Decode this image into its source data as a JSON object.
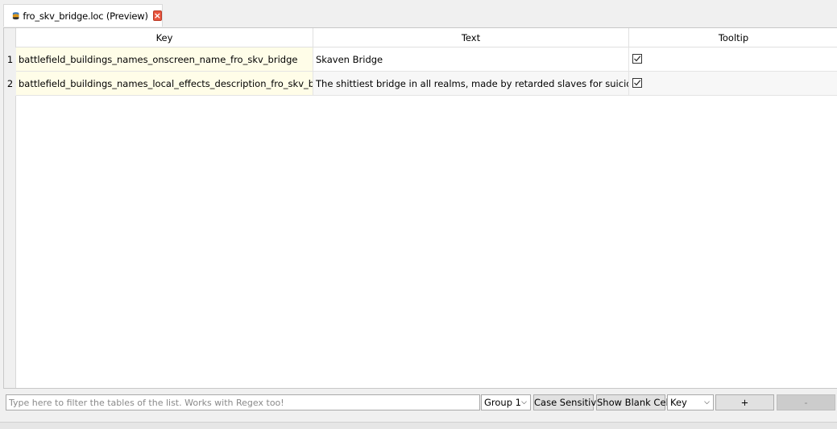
{
  "tab": {
    "title": "fro_skv_bridge.loc (Preview)",
    "icon": "database-icon",
    "close_icon": "close-icon"
  },
  "table": {
    "columns": [
      "Key",
      "Text",
      "Tooltip"
    ],
    "rows": [
      {
        "num": "1",
        "key": "battlefield_buildings_names_onscreen_name_fro_skv_bridge",
        "text": "Skaven Bridge",
        "tooltip": true
      },
      {
        "num": "2",
        "key": "battlefield_buildings_names_local_effects_description_fro_skv_bridge",
        "text": "The shittiest bridge in all realms, made by retarded slaves for suicidal rats.",
        "tooltip": true
      }
    ]
  },
  "filter": {
    "placeholder": "Type here to filter the tables of the list. Works with Regex too!",
    "value": "",
    "group_select": "Group 1",
    "case_sensitive_label": "Case Sensitive",
    "show_blank_cells_label": "Show Blank Cells",
    "column_select": "Key",
    "add_label": "+",
    "remove_label": "-"
  },
  "colors": {
    "key_cell_bg": "#fffde8",
    "close_red": "#e8553e"
  }
}
